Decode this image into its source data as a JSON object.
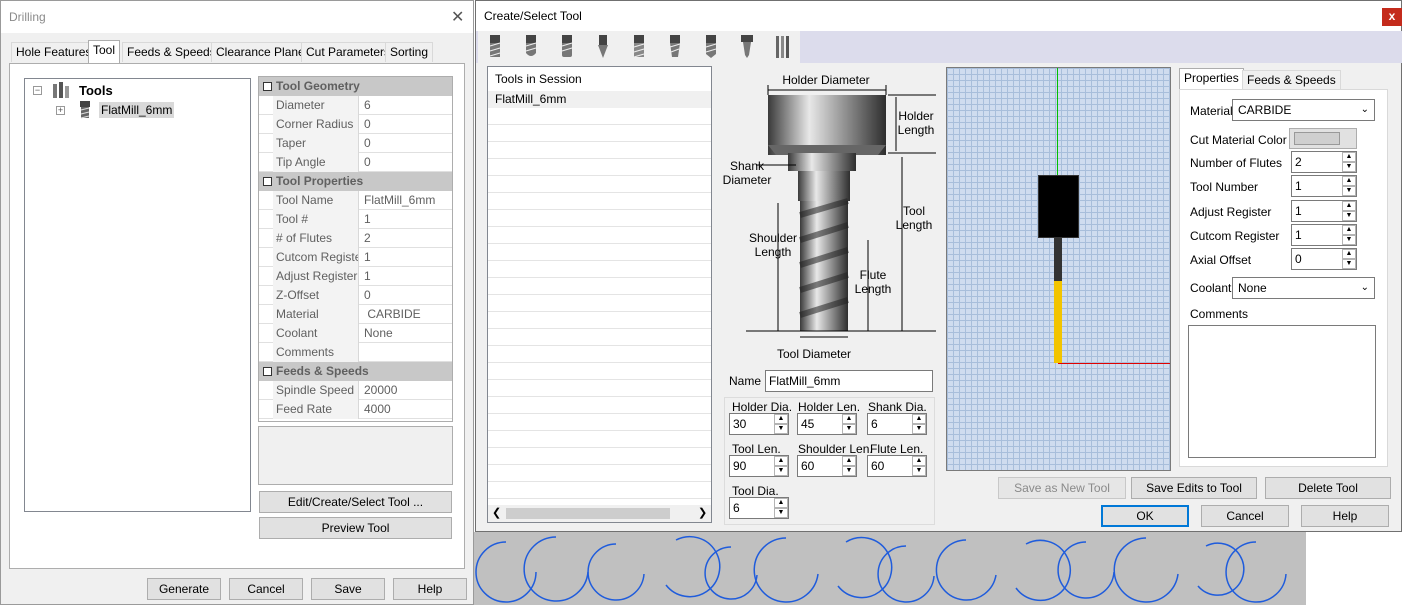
{
  "drilling": {
    "title": "Drilling",
    "tabs": [
      "Hole Features",
      "Tool",
      "Feeds & Speeds",
      "Clearance Plane",
      "Cut Parameters",
      "Sorting"
    ],
    "tree": {
      "root": "Tools",
      "child": "FlatMill_6mm"
    },
    "grid": {
      "cat_geometry": "Tool Geometry",
      "cat_properties": "Tool Properties",
      "cat_feeds": "Feeds & Speeds",
      "geometry": [
        {
          "name": "Diameter",
          "value": "6"
        },
        {
          "name": "Corner Radius",
          "value": "0"
        },
        {
          "name": "Taper",
          "value": "0"
        },
        {
          "name": "Tip Angle",
          "value": "0"
        }
      ],
      "properties": [
        {
          "name": "Tool Name",
          "value": "FlatMill_6mm"
        },
        {
          "name": "Tool #",
          "value": "1"
        },
        {
          "name": "# of Flutes",
          "value": "2"
        },
        {
          "name": "Cutcom Registe",
          "value": "1"
        },
        {
          "name": "Adjust Register",
          "value": "1"
        },
        {
          "name": "Z-Offset",
          "value": "0"
        },
        {
          "name": "Material",
          "value": " CARBIDE"
        },
        {
          "name": "Coolant",
          "value": "None"
        },
        {
          "name": "Comments",
          "value": ""
        }
      ],
      "feeds": [
        {
          "name": "Spindle Speed",
          "value": "20000"
        },
        {
          "name": "Feed Rate",
          "value": "4000"
        }
      ]
    },
    "buttons": {
      "edit_create": "Edit/Create/Select Tool ...",
      "preview": "Preview Tool",
      "generate": "Generate",
      "cancel": "Cancel",
      "save": "Save",
      "help": "Help"
    }
  },
  "create": {
    "title": "Create/Select Tool",
    "close": "x",
    "toolbar_icons": [
      "flat-mill-icon",
      "ball-mill-icon",
      "bull-mill-icon",
      "vbit-icon",
      "corner-round-icon",
      "taper-mill-icon",
      "drill-icon",
      "engrave-icon",
      "thread-mill-icon"
    ],
    "session_header": "Tools in Session",
    "session_items": [
      "FlatMill_6mm"
    ],
    "diagram": {
      "holder_diameter": "Holder Diameter",
      "holder_length": "Holder\nLength",
      "shank_diameter": "Shank\nDiameter",
      "tool_length": "Tool\nLength",
      "shoulder_length": "Shoulder\nLength",
      "flute_length": "Flute\nLength",
      "tool_diameter": "Tool Diameter"
    },
    "name_label": "Name",
    "name_value": "FlatMill_6mm",
    "dims": {
      "holder_dia_label": "Holder Dia.",
      "holder_dia": "30",
      "holder_len_label": "Holder Len.",
      "holder_len": "45",
      "shank_dia_label": "Shank Dia.",
      "shank_dia": "6",
      "tool_len_label": "Tool Len.",
      "tool_len": "90",
      "shoulder_len_label": "Shoulder Len.",
      "shoulder_len": "60",
      "flute_len_label": "Flute Len.",
      "flute_len": "60",
      "tool_dia_label": "Tool Dia.",
      "tool_dia": "6"
    },
    "prop_tabs": [
      "Properties",
      "Feeds & Speeds"
    ],
    "props": {
      "material_label": "Material",
      "material": "CARBIDE",
      "cut_color_label": "Cut Material Color",
      "flutes_label": "Number of Flutes",
      "flutes": "2",
      "tool_number_label": "Tool Number",
      "tool_number": "1",
      "adjust_label": "Adjust Register",
      "adjust": "1",
      "cutcom_label": "Cutcom Register",
      "cutcom": "1",
      "axial_label": "Axial Offset",
      "axial": "0",
      "coolant_label": "Coolant",
      "coolant": "None",
      "comments_label": "Comments"
    },
    "buttons": {
      "save_new": "Save as New Tool",
      "save_edits": "Save Edits to Tool",
      "delete": "Delete Tool",
      "ok": "OK",
      "cancel": "Cancel",
      "help": "Help"
    },
    "colors": {
      "toolbar_band": "#dcdcec",
      "preview_grid": "#c9d8ec",
      "flute_color": "#f2c400"
    }
  }
}
